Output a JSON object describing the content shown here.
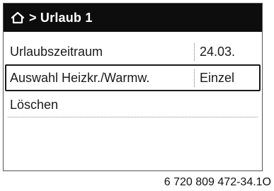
{
  "header": {
    "icon": "home-icon",
    "title": "> Urlaub 1"
  },
  "menu": {
    "items": [
      {
        "label": "Urlaubszeitraum",
        "value": "24.03."
      },
      {
        "label": "Auswahl Heizkr./Warmw.",
        "value": "Einzel",
        "selected": true
      },
      {
        "label": "Löschen"
      }
    ]
  },
  "caption": "6 720 809 472-34.1O",
  "colors": {
    "header_bg": "#0d0d0d",
    "header_text": "#ffffff",
    "text": "#1a1a1a"
  }
}
